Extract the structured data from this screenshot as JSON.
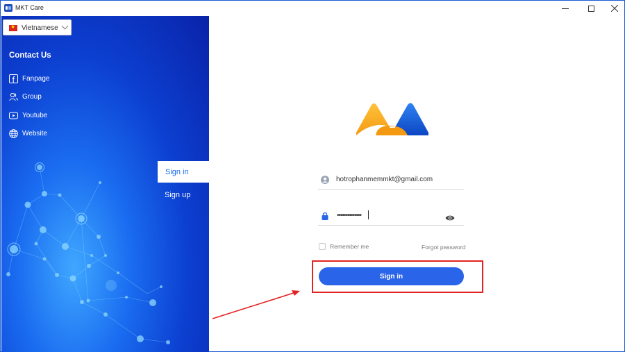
{
  "window": {
    "title": "MKT Care",
    "accent_color": "#1a6cf0",
    "controls": {
      "minimize_icon": "minimize-icon",
      "maximize_icon": "maximize-icon",
      "close_icon": "close-icon"
    }
  },
  "sidebar": {
    "language": {
      "selected": "Vietnamese",
      "flag_icon": "vietnam-flag-icon"
    },
    "contact_title": "Contact Us",
    "contact_items": [
      {
        "label": "Fanpage",
        "icon": "facebook-icon"
      },
      {
        "label": "Group",
        "icon": "group-icon"
      },
      {
        "label": "Youtube",
        "icon": "youtube-icon"
      },
      {
        "label": "Website",
        "icon": "globe-icon"
      }
    ],
    "tabs": [
      {
        "label": "Sign in",
        "active": true
      },
      {
        "label": "Sign up",
        "active": false
      }
    ]
  },
  "form": {
    "email_value": "hotrophanmemmkt@gmail.com",
    "password_masked": "••••••••••••••",
    "remember_label": "Remember me",
    "remember_checked": false,
    "forgot_label": "Forgot password",
    "submit_label": "Sign in",
    "submit_color": "#2a64e8"
  },
  "annotation": {
    "highlight_color": "#e32222"
  }
}
